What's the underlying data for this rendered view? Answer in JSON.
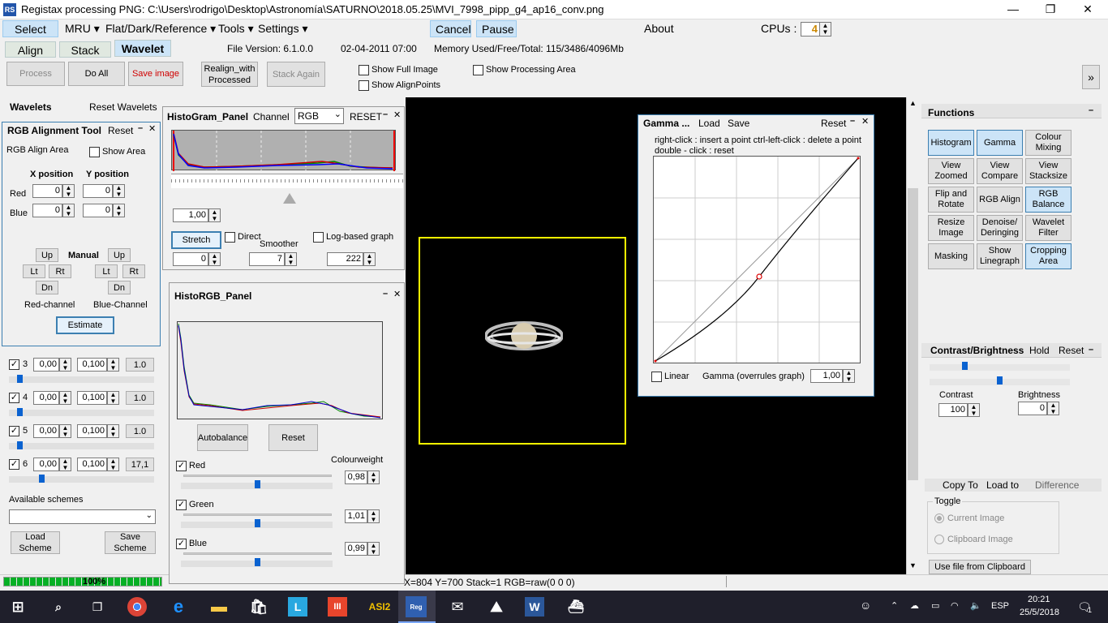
{
  "window": {
    "title": "Registax processing PNG: C:\\Users\\rodrigo\\Desktop\\Astronomía\\SATURNO\\2018.05.25\\MVI_7998_pipp_g4_ap16_conv.png",
    "icon": "RS"
  },
  "menu": {
    "select": "Select",
    "mru": "MRU",
    "flat": "Flat/Dark/Reference",
    "tools": "Tools",
    "settings": "Settings",
    "cancel": "Cancel",
    "pause": "Pause",
    "about": "About",
    "cpus_label": "CPUs :",
    "cpus_value": "4"
  },
  "tabs": {
    "align": "Align",
    "stack": "Stack",
    "wavelet": "Wavelet"
  },
  "info": {
    "file_version": "File Version: 6.1.0.0",
    "date": "02-04-2011 07:00",
    "memory": "Memory Used/Free/Total: 115/3486/4096Mb"
  },
  "toolbar": {
    "process": "Process",
    "do_all": "Do All",
    "save_image": "Save image",
    "realign1": "Realign_with",
    "realign2": "Processed",
    "stack_again": "Stack Again",
    "show_full_image": "Show Full Image",
    "show_alignpoints": "Show AlignPoints",
    "show_processing_area": "Show Processing Area",
    "expand": "»"
  },
  "wavelets": {
    "title": "Wavelets",
    "reset": "Reset Wavelets",
    "rows": [
      {
        "n": "3",
        "a": "0,00",
        "b": "0,100",
        "c": "1.0"
      },
      {
        "n": "4",
        "a": "0,00",
        "b": "0,100",
        "c": "1.0"
      },
      {
        "n": "5",
        "a": "0,00",
        "b": "0,100",
        "c": "1.0"
      },
      {
        "n": "6",
        "a": "0,00",
        "b": "0,100",
        "c": "17,1"
      }
    ],
    "available_schemes": "Available schemes",
    "load_scheme1": "Load",
    "load_scheme2": "Scheme",
    "save_scheme1": "Save",
    "save_scheme2": "Scheme",
    "progress": "100%"
  },
  "rgb_align": {
    "title": "RGB Alignment Tool",
    "reset": "Reset",
    "area": "RGB Align Area",
    "show_area": "Show Area",
    "x_pos": "X position",
    "y_pos": "Y position",
    "red": "Red",
    "blue": "Blue",
    "red_x": "0",
    "red_y": "0",
    "blue_x": "0",
    "blue_y": "0",
    "up": "Up",
    "lt": "Lt",
    "rt": "Rt",
    "dn": "Dn",
    "manual": "Manual",
    "red_channel": "Red-channel",
    "blue_channel": "Blue-Channel",
    "estimate": "Estimate"
  },
  "histogram": {
    "title": "HistoGram_Panel",
    "channel_label": "Channel",
    "channel_value": "RGB",
    "reset": "RESET",
    "value": "1,00",
    "stretch": "Stretch",
    "direct": "Direct",
    "smoother": "Smoother",
    "log_graph": "Log-based graph",
    "low": "0",
    "smooth": "7",
    "high": "222"
  },
  "historgb": {
    "title": "HistoRGB_Panel",
    "autobalance": "Autobalance",
    "reset": "Reset",
    "colourweight": "Colourweight",
    "red": "Red",
    "red_val": "0,98",
    "green": "Green",
    "green_val": "1,01",
    "blue": "Blue",
    "blue_val": "0,99"
  },
  "gamma": {
    "title": "Gamma ...",
    "load": "Load",
    "save": "Save",
    "reset": "Reset",
    "hint1": "right-click : insert a point   ctrl-left-click : delete a point",
    "hint2": "double - click : reset",
    "linear": "Linear",
    "overrules": "Gamma (overrules graph)",
    "value": "1,00"
  },
  "functions": {
    "title": "Functions",
    "buttons": [
      [
        "Histogram",
        "Gamma",
        "Colour Mixing"
      ],
      [
        "View Zoomed",
        "View Compare",
        "View Stacksize"
      ],
      [
        "Flip and Rotate",
        "RGB Align",
        "RGB Balance"
      ],
      [
        "Resize Image",
        "Denoise/ Deringing",
        "Wavelet Filter"
      ],
      [
        "Masking",
        "Show Linegraph",
        "Cropping Area"
      ]
    ]
  },
  "contrast": {
    "title": "Contrast/Brightness",
    "hold": "Hold",
    "reset": "Reset",
    "contrast": "Contrast",
    "contrast_val": "100",
    "brightness": "Brightness",
    "brightness_val": "0"
  },
  "copy": {
    "copy_to": "Copy To",
    "load_to": "Load to",
    "difference": "Difference",
    "toggle": "Toggle",
    "current": "Current Image",
    "clipboard": "Clipboard Image",
    "use_file": "Use file from Clipboard"
  },
  "status": {
    "coords": "X=804 Y=700 Stack=1 RGB=raw(0 0 0)"
  },
  "taskbar": {
    "time": "20:21",
    "date": "25/5/2018",
    "lang": "ESP",
    "notif": "1"
  },
  "colors": {
    "accent": "#cce4f7",
    "selection": "#ffff00",
    "red": "#e00000"
  }
}
